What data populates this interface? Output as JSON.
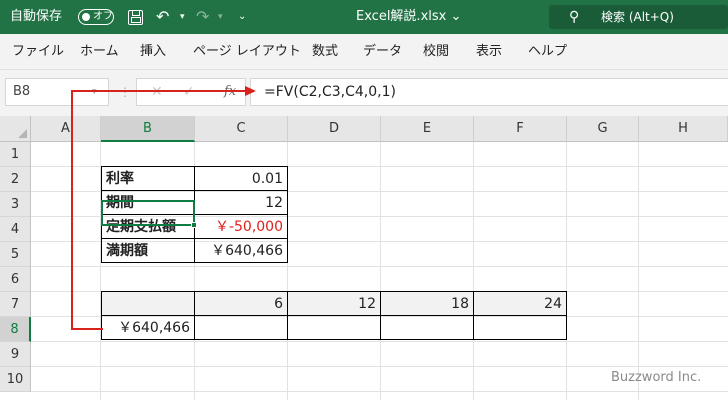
{
  "titlebar": {
    "autosave_label": "自動保存",
    "autosave_toggle": "オフ",
    "filename": "Excel解説.xlsx",
    "filename_chevron": "⌄",
    "search_placeholder": "検索 (Alt+Q)",
    "icons": [
      "save-icon",
      "undo-icon",
      "redo-icon",
      "customize-qat-icon",
      "search-icon"
    ]
  },
  "ribbon": {
    "tabs": [
      "ファイル",
      "ホーム",
      "挿入",
      "ページ レイアウト",
      "数式",
      "データ",
      "校閲",
      "表示",
      "ヘルプ"
    ]
  },
  "formula_bar": {
    "name_box": "B8",
    "formula": "=FV(C2,C3,C4,0,1)",
    "fx_label": "fx"
  },
  "grid": {
    "columns": [
      "A",
      "B",
      "C",
      "D",
      "E",
      "F",
      "G",
      "H"
    ],
    "rows": [
      "1",
      "2",
      "3",
      "4",
      "5",
      "6",
      "7",
      "8",
      "9",
      "10"
    ],
    "selected_column": "B",
    "selected_row": "8",
    "table": [
      {
        "label": "利率",
        "value": "0.01"
      },
      {
        "label": "期間",
        "value": "12"
      },
      {
        "label": "定期支払額",
        "value": "￥-50,000",
        "value_color": "#e0201b"
      },
      {
        "label": "満期額",
        "value": "￥640,466"
      }
    ],
    "row7": [
      "",
      "6",
      "12",
      "18",
      "24"
    ],
    "row8": [
      "￥640,466",
      "",
      "",
      "",
      ""
    ]
  },
  "colors": {
    "excel_green": "#217346",
    "selection_green": "#107c41",
    "arrow_red": "#d9221c",
    "negative_red": "#e0201b"
  },
  "watermark": "Buzzword Inc."
}
